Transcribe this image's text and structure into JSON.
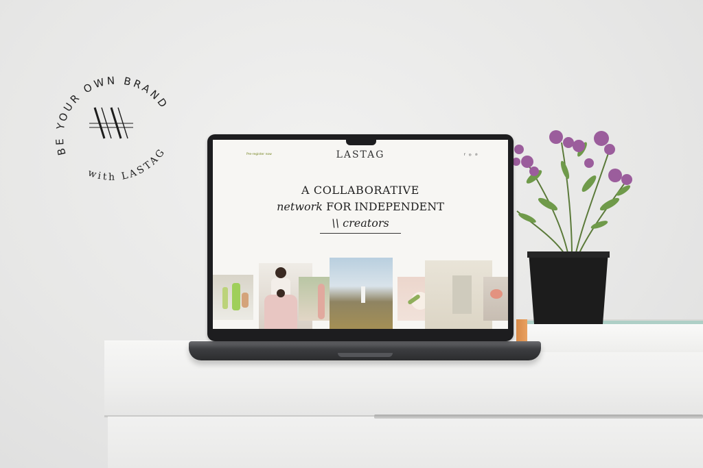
{
  "badge": {
    "ring_text_top": "BE YOUR OWN BRAND",
    "ring_text_bottom": "with LASTAG",
    "monogram": "logo-monogram-icon"
  },
  "website": {
    "preregister_link": "Pre-register now",
    "logo": "LASTAG",
    "social_icons": [
      "facebook-icon",
      "instagram-icon",
      "pinterest-icon"
    ],
    "social_glyphs": [
      "f",
      "◎",
      "℗"
    ],
    "headline": {
      "line1": "A COLLABORATIVE",
      "line2_italic": "network",
      "line2_rest": " FOR INDEPENDENT",
      "line3": "\\\\ creators"
    },
    "colors": {
      "accent": "#6f7f17",
      "background": "#f7f6f3",
      "text": "#1f1f1f"
    }
  }
}
